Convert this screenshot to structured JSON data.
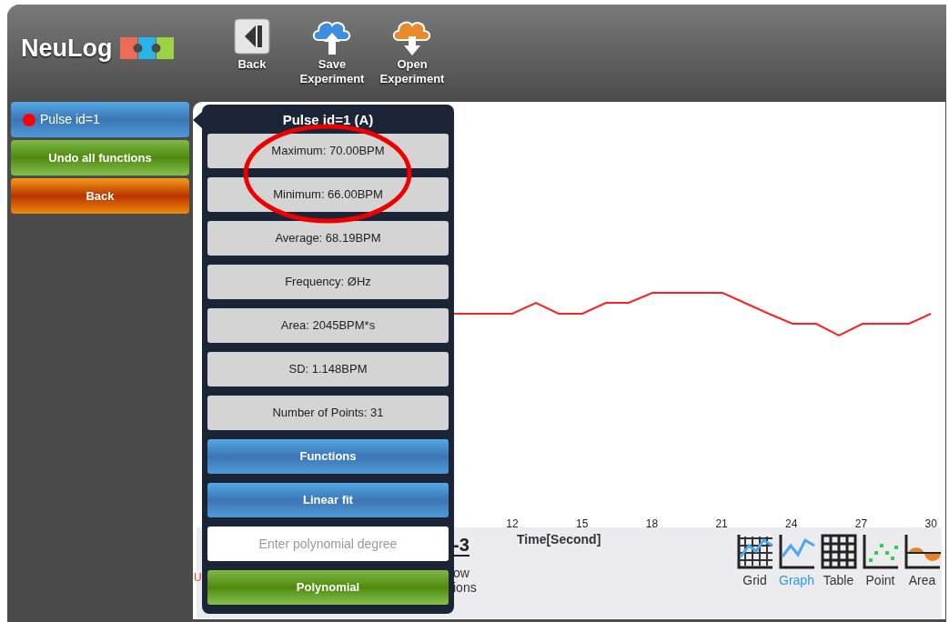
{
  "header": {
    "logo": "NeuLog",
    "toolbar": [
      {
        "label": "Back",
        "kind": "back"
      },
      {
        "label": "Save Experiment",
        "kind": "save"
      },
      {
        "label": "Open Experiment",
        "kind": "open"
      }
    ]
  },
  "sidebar": {
    "sensor": {
      "label": "Pulse id=1",
      "color": "#ff0000"
    },
    "buttons": [
      {
        "label": "Undo all functions",
        "kind": "green"
      },
      {
        "label": "Back",
        "kind": "orange"
      }
    ]
  },
  "popup": {
    "title": "Pulse id=1 (A)",
    "stats": [
      "Maximum: 70.00BPM",
      "Minimum: 66.00BPM",
      "Average: 68.19BPM",
      "Frequency: ØHz",
      "Area: 2045BPM*s",
      "SD: 1.148BPM",
      "Number of Points: 31"
    ],
    "actions": [
      {
        "kind": "blue",
        "label": "Functions"
      },
      {
        "kind": "blue",
        "label": "Linear fit"
      },
      {
        "kind": "input",
        "placeholder": "Enter polynomial degree"
      },
      {
        "kind": "green",
        "label": "Polynomial"
      }
    ]
  },
  "chart": {
    "xticks": [
      "12",
      "15",
      "18",
      "21",
      "24",
      "27",
      "30"
    ],
    "xlabel": "Time[Second]"
  },
  "bottom_toolbar": {
    "left_fragment": "U",
    "fragment_title": "-3",
    "fragment_lines": [
      "ow",
      "ions"
    ],
    "views": [
      {
        "label": "Grid",
        "kind": "grid",
        "selected": false
      },
      {
        "label": "Graph",
        "kind": "graph",
        "selected": true
      },
      {
        "label": "Table",
        "kind": "table",
        "selected": false
      },
      {
        "label": "Point",
        "kind": "point",
        "selected": false
      },
      {
        "label": "Area",
        "kind": "area",
        "selected": false
      }
    ]
  }
}
